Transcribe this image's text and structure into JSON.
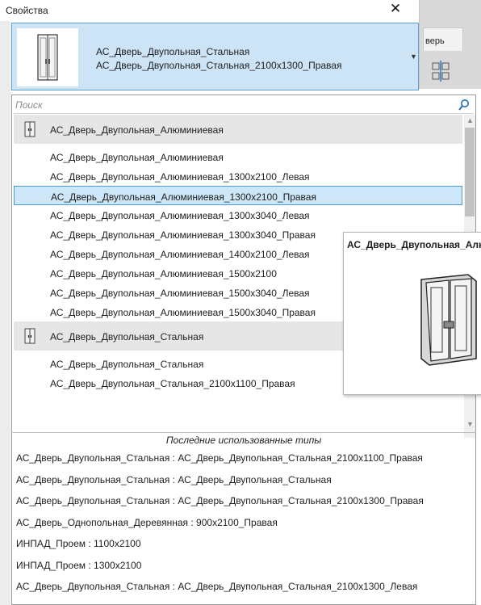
{
  "window": {
    "title": "Свойства"
  },
  "ribbon": {
    "tab_label": "верь"
  },
  "type_selector": {
    "family": "АС_Дверь_Двупольная_Стальная",
    "type": "АС_Дверь_Двупольная_Стальная_2100x1300_Правая"
  },
  "search": {
    "placeholder": "Поиск"
  },
  "list": {
    "items": [
      {
        "label": "АС_Дверь_Двупольная_Алюминиевая",
        "kind": "group"
      },
      {
        "label": "АС_Дверь_Двупольная_Алюминиевая",
        "kind": "item"
      },
      {
        "label": "АС_Дверь_Двупольная_Алюминиевая_1300x2100_Левая",
        "kind": "item"
      },
      {
        "label": "АС_Дверь_Двупольная_Алюминиевая_1300x2100_Правая",
        "kind": "selected"
      },
      {
        "label": "АС_Дверь_Двупольная_Алюминиевая_1300x3040_Левая",
        "kind": "item"
      },
      {
        "label": "АС_Дверь_Двупольная_Алюминиевая_1300x3040_Правая",
        "kind": "item"
      },
      {
        "label": "АС_Дверь_Двупольная_Алюминиевая_1400x2100_Левая",
        "kind": "item"
      },
      {
        "label": "АС_Дверь_Двупольная_Алюминиевая_1500x2100",
        "kind": "item"
      },
      {
        "label": "АС_Дверь_Двупольная_Алюминиевая_1500x3040_Левая",
        "kind": "item"
      },
      {
        "label": "АС_Дверь_Двупольная_Алюминиевая_1500x3040_Правая",
        "kind": "item"
      },
      {
        "label": "АС_Дверь_Двупольная_Стальная",
        "kind": "group"
      },
      {
        "label": "АС_Дверь_Двупольная_Стальная",
        "kind": "item"
      },
      {
        "label": "АС_Дверь_Двупольная_Стальная_2100x1100_Правая",
        "kind": "item"
      }
    ]
  },
  "preview": {
    "title": "АС_Дверь_Двупольная_Алюминиевая"
  },
  "recent": {
    "header": "Последние использованные типы",
    "items": [
      "АС_Дверь_Двупольная_Стальная : АС_Дверь_Двупольная_Стальная_2100x1100_Правая",
      "АС_Дверь_Двупольная_Стальная : АС_Дверь_Двупольная_Стальная",
      "АС_Дверь_Двупольная_Стальная : АС_Дверь_Двупольная_Стальная_2100x1300_Правая",
      "АС_Дверь_Однопольная_Деревянная : 900x2100_Правая",
      "ИНПАД_Проем : 1100x2100",
      "ИНПАД_Проем : 1300x2100",
      "АС_Дверь_Двупольная_Стальная : АС_Дверь_Двупольная_Стальная_2100x1300_Левая"
    ]
  },
  "colors": {
    "selection": "#cde7f9",
    "selection_border": "#4a9bd6",
    "group_bg": "#e6e6e6",
    "selector_bg": "#cde4f7"
  }
}
